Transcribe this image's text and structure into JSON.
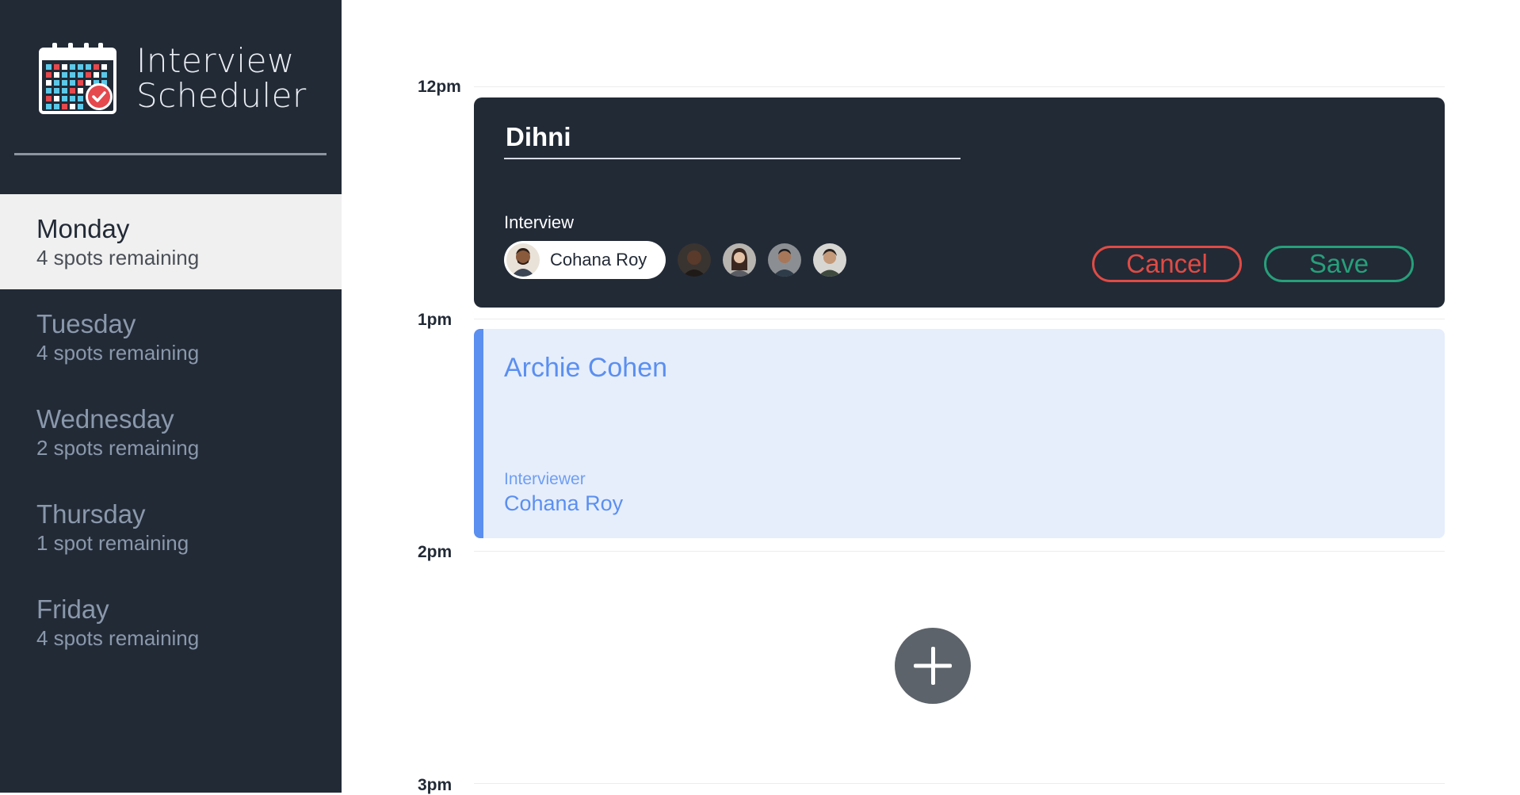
{
  "app": {
    "title_line1": "Interview",
    "title_line2": "Scheduler",
    "logo_icon": "calendar-check-icon"
  },
  "days": [
    {
      "name": "Monday",
      "spots": "4 spots remaining",
      "selected": true
    },
    {
      "name": "Tuesday",
      "spots": "4 spots remaining",
      "selected": false
    },
    {
      "name": "Wednesday",
      "spots": "2 spots remaining",
      "selected": false
    },
    {
      "name": "Thursday",
      "spots": "1 spot remaining",
      "selected": false
    },
    {
      "name": "Friday",
      "spots": "4 spots remaining",
      "selected": false
    }
  ],
  "times": [
    "12pm",
    "1pm",
    "2pm",
    "3pm"
  ],
  "edit_form": {
    "student_name": "Dihni",
    "interview_label": "Interview",
    "selected_interviewer": "Cohana Roy",
    "cancel_label": "Cancel",
    "save_label": "Save"
  },
  "booked": {
    "student": "Archie Cohen",
    "interviewer_label": "Interviewer",
    "interviewer_name": "Cohana Roy"
  },
  "colors": {
    "sidebar": "#222a36",
    "cancel": "#e04b44",
    "save": "#26a07a",
    "booked_accent": "#5b8ff0",
    "booked_bg": "#e6eefc",
    "add_button": "#5d636a"
  },
  "icons": {
    "add": "plus-icon"
  }
}
